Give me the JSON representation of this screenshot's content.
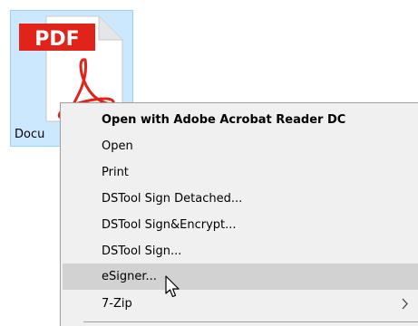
{
  "file": {
    "icon_badge": "PDF",
    "label": "Docu"
  },
  "context_menu": {
    "items": [
      {
        "label": "Open with Adobe Acrobat Reader DC",
        "default": true
      },
      {
        "label": "Open"
      },
      {
        "label": "Print"
      },
      {
        "label": "DSTool Sign Detached..."
      },
      {
        "label": "DSTool Sign&Encrypt..."
      },
      {
        "label": "DSTool Sign..."
      },
      {
        "label": "eSigner...",
        "hovered": true
      },
      {
        "label": "7-Zip",
        "has_submenu": true
      }
    ]
  },
  "colors": {
    "selection_fill": "#cce8ff",
    "pdf_red": "#e2231a",
    "menu_bg": "#f0f0f0",
    "menu_hover": "#d2d2d2"
  }
}
